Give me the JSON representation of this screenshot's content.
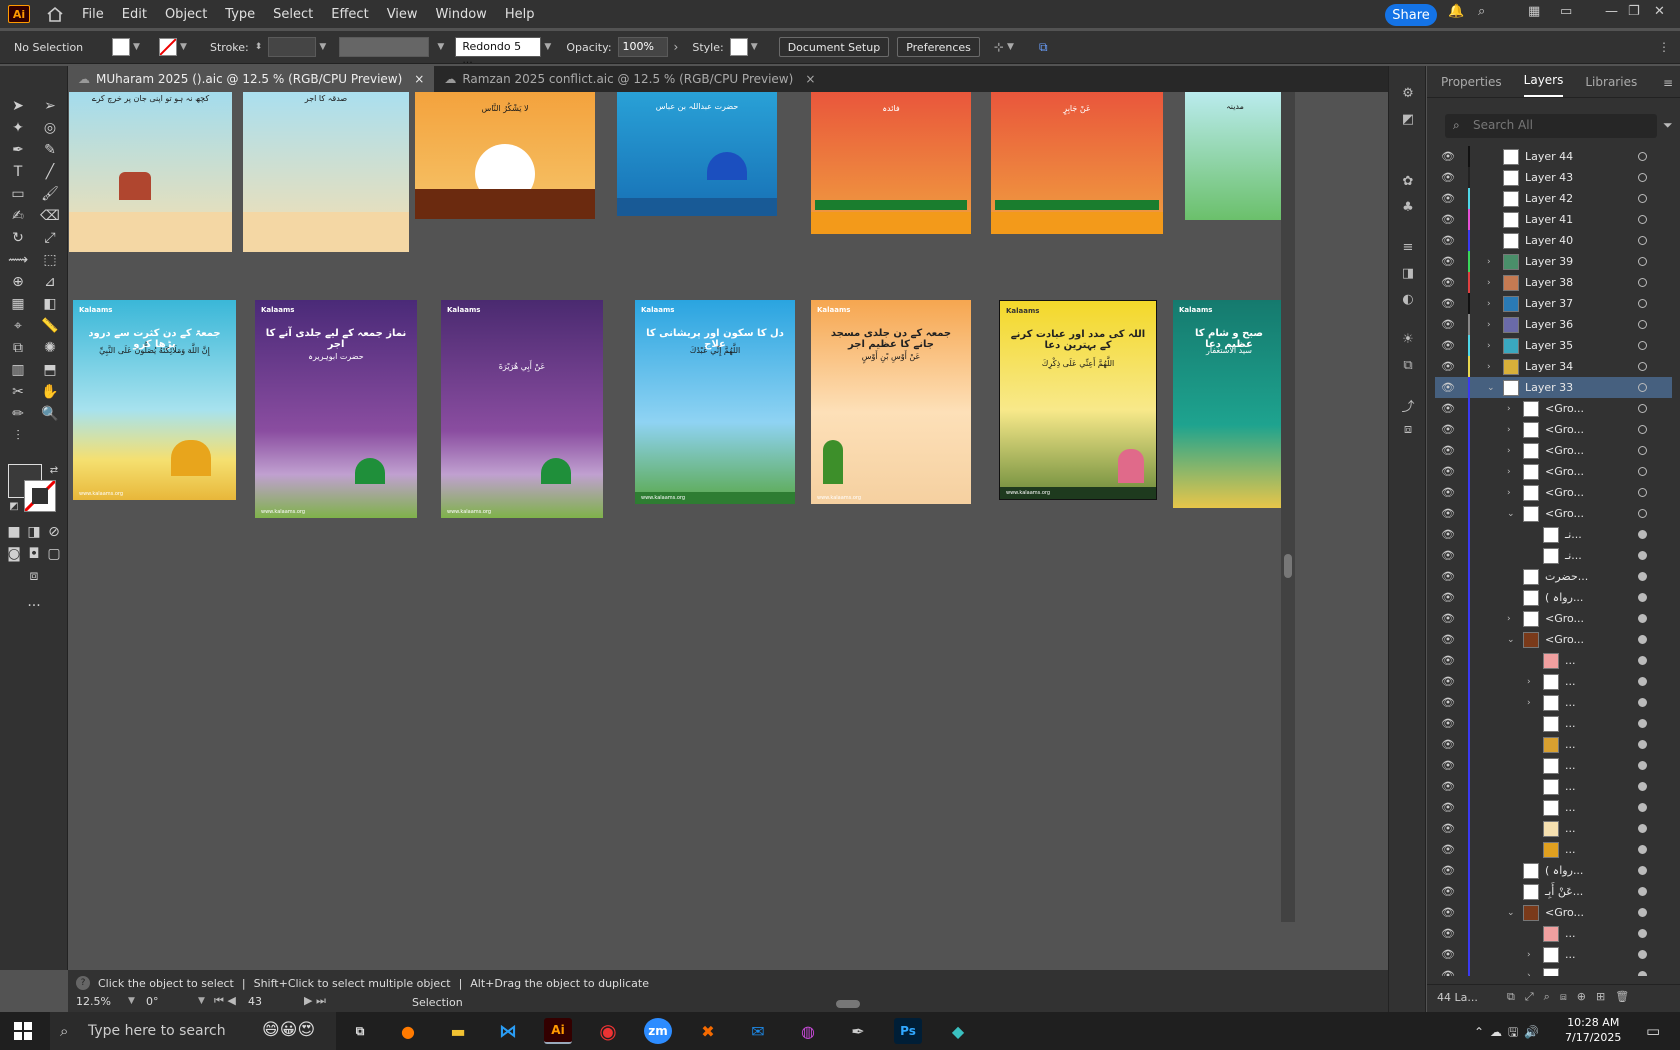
{
  "app": {
    "logo": "Ai"
  },
  "menu": [
    "File",
    "Edit",
    "Object",
    "Type",
    "Select",
    "Effect",
    "View",
    "Window",
    "Help"
  ],
  "share_label": "Share",
  "control": {
    "selection": "No Selection",
    "stroke_label": "Stroke:",
    "font_name": "Redondo 5 ...",
    "opacity_label": "Opacity:",
    "opacity_value": "100%",
    "style_label": "Style:",
    "doc_setup": "Document Setup",
    "preferences": "Preferences"
  },
  "tabs": [
    {
      "label": "MUharam 2025 ().aic @ 12.5 % (RGB/CPU Preview)",
      "close": "×"
    },
    {
      "label": "Ramzan 2025 conflict.aic @ 12.5 % (RGB/CPU Preview)",
      "close": "×"
    }
  ],
  "status": {
    "tip1": "Click the object to select",
    "tip2": "Shift+Click to select multiple object",
    "tip3": "Alt+Drag the object to duplicate",
    "zoom": "12.5%",
    "rotation": "0°",
    "artboard": "43",
    "mode": "Selection"
  },
  "artboards": {
    "brand": "Kalaams",
    "website": "www.kalaams.org",
    "row2_titles": [
      "جمعۃ کے دن کثرت سے درود پڑھا کرو",
      "نماز جمعہ کے لیے جلدی آنے کا اجر",
      "",
      "دل کا سکون اور پریشانی کا علاج",
      "جمعہ کے دن جلدی مسجد جانے کا عظیم اجر",
      "اللہ کی مدد اور عبادت کرنے کے بہترین دعا",
      "صبح و شام کا عظیم دعا"
    ]
  },
  "panel": {
    "tabs": [
      "Properties",
      "Layers",
      "Libraries"
    ],
    "search_placeholder": "Search All",
    "layers": [
      {
        "name": "Layer 44",
        "color": "#111111"
      },
      {
        "name": "Layer 43",
        "color": "#222222"
      },
      {
        "name": "Layer 42",
        "color": "#4fd6e8"
      },
      {
        "name": "Layer 41",
        "color": "#e84fd6"
      },
      {
        "name": "Layer 40",
        "color": "#3a3af0"
      },
      {
        "name": "Layer 39",
        "color": "#3ad65a"
      },
      {
        "name": "Layer 38",
        "color": "#e04040"
      },
      {
        "name": "Layer 37",
        "color": "#111111"
      },
      {
        "name": "Layer 36",
        "color": "#888888"
      },
      {
        "name": "Layer 35",
        "color": "#4fd6e8"
      },
      {
        "name": "Layer 34",
        "color": "#e8d64f"
      },
      {
        "name": "Layer 33",
        "color": "#3a3af0"
      },
      {
        "name": "<Gro..."
      },
      {
        "name": "<Gro..."
      },
      {
        "name": "<Gro..."
      },
      {
        "name": "<Gro..."
      },
      {
        "name": "<Gro..."
      },
      {
        "name": "<Gro..."
      },
      {
        "name": "نـ..."
      },
      {
        "name": "نـ..."
      },
      {
        "name": "حضرت..."
      },
      {
        "name": "( رواہ..."
      },
      {
        "name": "<Gro..."
      },
      {
        "name": "<Gro..."
      },
      {
        "name": "..."
      },
      {
        "name": "..."
      },
      {
        "name": "..."
      },
      {
        "name": "..."
      },
      {
        "name": "..."
      },
      {
        "name": "..."
      },
      {
        "name": "..."
      },
      {
        "name": "..."
      },
      {
        "name": "..."
      },
      {
        "name": "..."
      },
      {
        "name": "( رواہ..."
      },
      {
        "name": "عَنْ أَبِـ..."
      },
      {
        "name": "<Gro..."
      },
      {
        "name": "..."
      },
      {
        "name": "..."
      },
      {
        "name": "..."
      }
    ],
    "footer": "44 La..."
  },
  "taskbar": {
    "search_placeholder": "Type here to search",
    "time": "10:28 AM",
    "date": "7/17/2025",
    "apps": [
      "Ai",
      "zm",
      "Ps"
    ]
  }
}
